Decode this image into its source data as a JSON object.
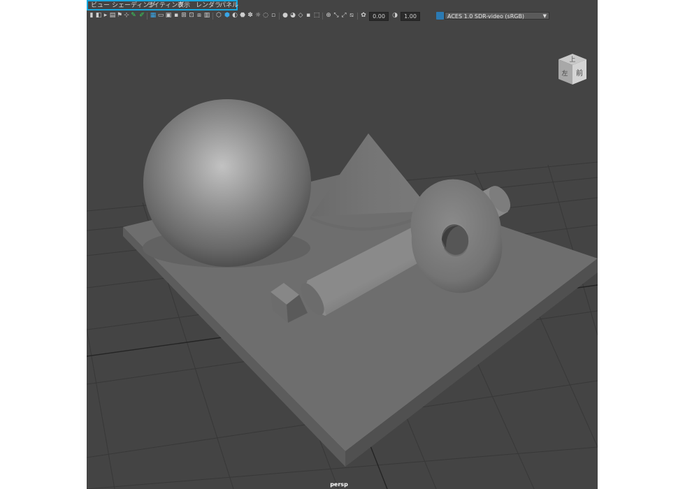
{
  "menubar": {
    "items": [
      {
        "label": "ビュー"
      },
      {
        "label": "シェーディング"
      },
      {
        "label": "ライティング"
      },
      {
        "label": "表示"
      },
      {
        "label": "レンダラ"
      },
      {
        "label": "パネル"
      }
    ]
  },
  "toolbar": {
    "exposure_value": "0.00",
    "gamma_value": "1.00",
    "color_management": "ACES 1.0 SDR-video (sRGB)"
  },
  "viewport": {
    "camera_name": "persp",
    "viewcube": {
      "top_label": "上",
      "front_label": "前",
      "left_label": "左"
    }
  },
  "colors": {
    "highlight": "#16a8e0",
    "toolbar_blue": "#39a5e6",
    "toolbar_green": "#39d35b",
    "background": "#444444"
  }
}
